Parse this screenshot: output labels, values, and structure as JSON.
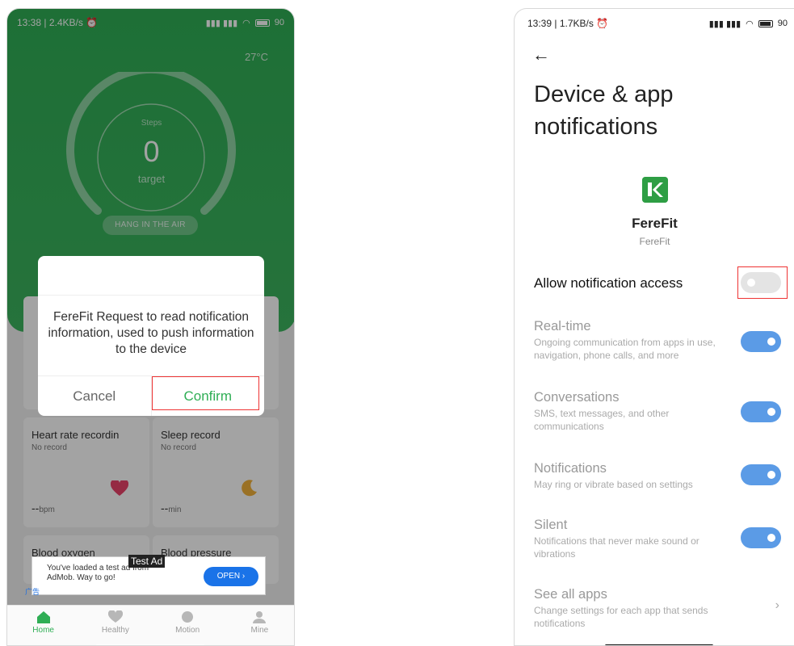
{
  "left": {
    "status": {
      "time": "13:38 | 2.4KB/s ⏰",
      "battery": "90"
    },
    "temperature": "27°C",
    "steps_label": "Steps",
    "steps_value": "0",
    "target_label": "target",
    "hang_button": "HANG IN THE AIR",
    "dialog": {
      "message": "FereFit Request to read notification information, used to push information to the device",
      "cancel": "Cancel",
      "confirm": "Confirm"
    },
    "cards": [
      {
        "title": "Heart rate recordin",
        "sub": "No record",
        "value": "--",
        "unit": "bpm"
      },
      {
        "title": "Sleep record",
        "sub": "No record",
        "value": "--",
        "unit": "min"
      }
    ],
    "cards_row3": [
      "Blood oxygen",
      "Blood pressure"
    ],
    "ad": {
      "text_line1": "You've loaded a test ad from",
      "text_line2": "AdMob. Way to go!",
      "open": "OPEN ›",
      "test_tag": "Test Ad",
      "guang": "广告"
    },
    "tabs": [
      {
        "label": "Home",
        "icon": "home-icon"
      },
      {
        "label": "Healthy",
        "icon": "heart-icon"
      },
      {
        "label": "Motion",
        "icon": "run-icon"
      },
      {
        "label": "Mine",
        "icon": "person-icon"
      }
    ],
    "colors": {
      "green": "#2fae55",
      "ad_blue": "#1a73e8"
    }
  },
  "right": {
    "status": {
      "time": "13:39 | 1.7KB/s ⏰",
      "battery": "90"
    },
    "back_icon": "←",
    "title": "Device & app notifications",
    "app": {
      "name": "FereFit",
      "sub": "FereFit"
    },
    "allow_label": "Allow notification access",
    "rows": [
      {
        "title": "Real-time",
        "desc": "Ongoing communication from apps in use, navigation, phone calls, and more"
      },
      {
        "title": "Conversations",
        "desc": "SMS, text messages, and other communications"
      },
      {
        "title": "Notifications",
        "desc": "May ring or vibrate based on settings"
      },
      {
        "title": "Silent",
        "desc": "Notifications that never make sound or vibrations"
      }
    ],
    "see_all": {
      "title": "See all apps",
      "desc": "Change settings for each app that sends notifications"
    },
    "colors": {
      "toggle_on": "#5b9be6"
    }
  }
}
